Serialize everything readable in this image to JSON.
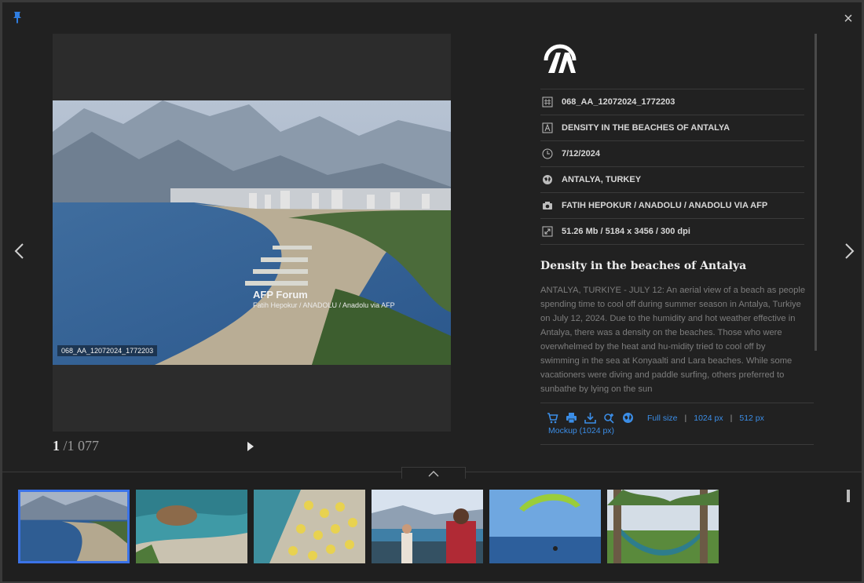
{
  "viewer": {
    "close_label": "×",
    "counter": {
      "current": "1",
      "total": "/1 077"
    }
  },
  "photo": {
    "id_label": "068_AA_12072024_1772203",
    "watermark_title": "AFP Forum",
    "watermark_credit": "Fatih Hepokur / ANADOLU / Anadolu via AFP"
  },
  "meta": {
    "rows": [
      {
        "icon": "hash-icon",
        "text": "068_AA_12072024_1772203"
      },
      {
        "icon": "title-icon",
        "text": "DENSITY IN THE BEACHES OF ANTALYA"
      },
      {
        "icon": "clock-icon",
        "text": "7/12/2024"
      },
      {
        "icon": "globe-icon",
        "text": "ANTALYA, TURKEY"
      },
      {
        "icon": "camera-icon",
        "text": "FATIH HEPOKUR / ANADOLU / ANADOLU VIA AFP"
      },
      {
        "icon": "resize-icon",
        "text": "51.26 Mb / 5184 x 3456 / 300 dpi"
      }
    ]
  },
  "description": {
    "title": "Density in the beaches of Antalya",
    "body": "ANTALYA, TURKIYE - JULY 12: An aerial view of a beach as people spending time to cool off during summer season in Antalya, Turkiye on July 12, 2024. Due to the humidity and hot weather effective in Antalya, there was a density on the beaches. Those who were overwhelmed by the heat and hu-midity tried to cool off by swimming in the sea at Konyaalti and Lara beaches. While some vacationers were diving and paddle surfing, others preferred to sunbathe by lying on the sun"
  },
  "actions": {
    "full_size": "Full size",
    "size_1024": "1024 px",
    "size_512": "512 px",
    "separator": "|",
    "mockup": "Mockup (1024 px)"
  },
  "colors": {
    "accent": "#3b8de6",
    "active_border": "#3b73e8",
    "background": "#212121"
  },
  "thumbnails": [
    {
      "name": "thumb-beach-aerial",
      "active": true
    },
    {
      "name": "thumb-rock-sea"
    },
    {
      "name": "thumb-umbrellas"
    },
    {
      "name": "thumb-tourists"
    },
    {
      "name": "thumb-paraglider"
    },
    {
      "name": "thumb-hammock"
    }
  ]
}
